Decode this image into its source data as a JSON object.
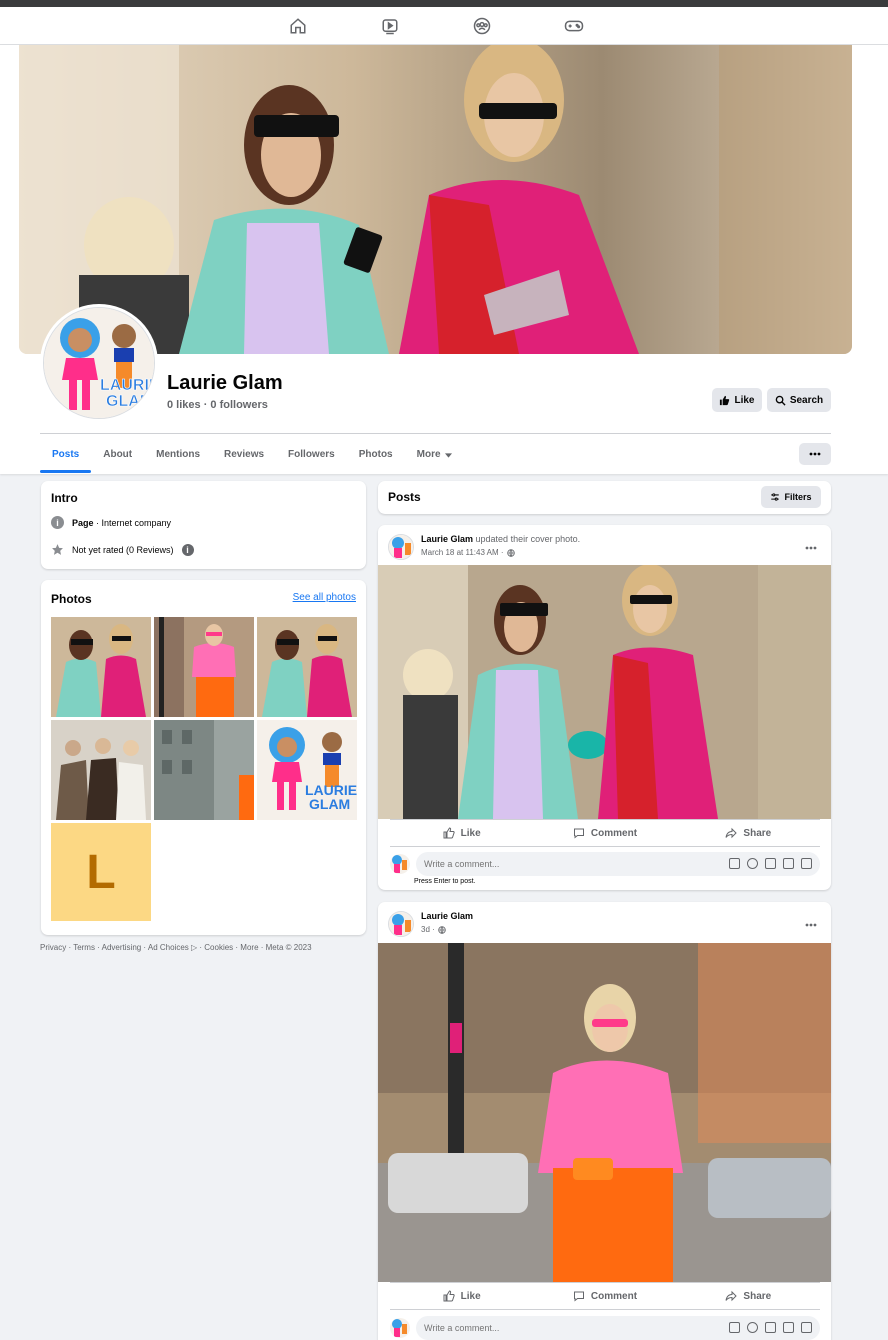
{
  "nav": {
    "icons": [
      "home-icon",
      "watch-icon",
      "groups-icon",
      "gaming-icon"
    ]
  },
  "page": {
    "name": "Laurie Glam",
    "likes": "0 likes",
    "followers": "0 followers",
    "avatar_text": "LAURIE GLAM",
    "like_button": "Like",
    "search_button": "Search"
  },
  "tabs": [
    "Posts",
    "About",
    "Mentions",
    "Reviews",
    "Followers",
    "Photos",
    "More"
  ],
  "intro": {
    "title": "Intro",
    "page_label": "Page",
    "page_category": " · Internet company",
    "rating": "Not yet rated (0 Reviews)"
  },
  "photos": {
    "title": "Photos",
    "see_all": "See all photos",
    "placeholder_letter": "L"
  },
  "footer": "Privacy · Terms · Advertising · Ad Choices ▷ · Cookies · More · Meta © 2023",
  "posts_section": {
    "title": "Posts",
    "filters": "Filters"
  },
  "posts": [
    {
      "author": "Laurie Glam",
      "action": " updated their cover photo.",
      "time": "March 18 at 11:43 AM ·",
      "like": "Like",
      "comment": "Comment",
      "share": "Share",
      "comment_placeholder": "Write a comment...",
      "hint": "Press Enter to post."
    },
    {
      "author": "Laurie Glam",
      "action": "",
      "time": "3d ·",
      "like": "Like",
      "comment": "Comment",
      "share": "Share",
      "comment_placeholder": "Write a comment..."
    }
  ],
  "colors": {
    "accent": "#1877f2",
    "background": "#f0f2f5",
    "placeholder_tile": "#fcd884",
    "placeholder_letter": "#b36b00"
  }
}
